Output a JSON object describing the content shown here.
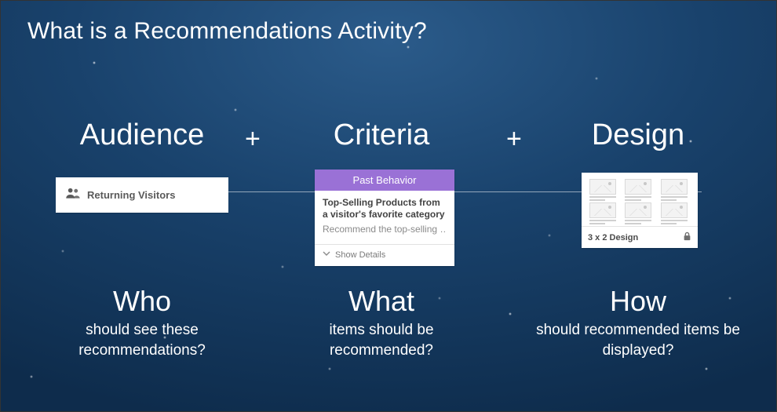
{
  "title": "What is a Recommendations Activity?",
  "plus": "+",
  "cols": {
    "audience": {
      "heading": "Audience",
      "card_label": "Returning Visitors",
      "q_big": "Who",
      "q_small": "should see these recommendations?"
    },
    "criteria": {
      "heading": "Criteria",
      "bar": "Past Behavior",
      "card_title": "Top-Selling Products from a visitor's favorite category",
      "card_desc": "Recommend the top-selling …",
      "show_details": "Show Details",
      "q_big": "What",
      "q_small": "items should be recommended?"
    },
    "design": {
      "heading": "Design",
      "caption": "3 x 2 Design",
      "q_big": "How",
      "q_small": "should recommended items be displayed?"
    }
  }
}
